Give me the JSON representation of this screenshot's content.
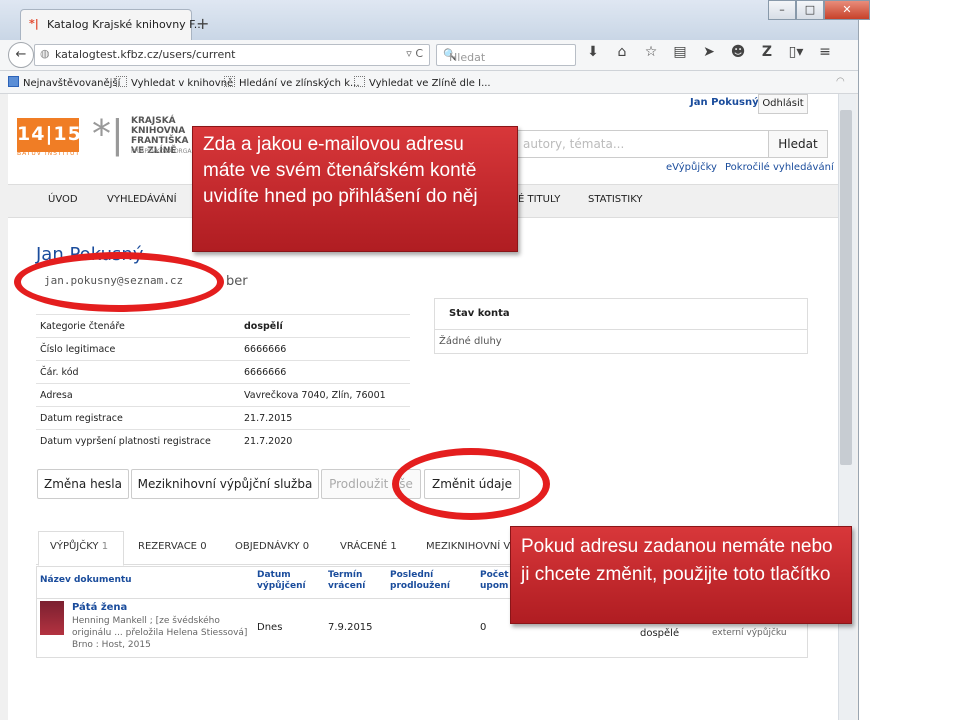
{
  "browser": {
    "tab_title": "Katalog Krajské knihovny F...",
    "tab_favicon": "*|",
    "url": "katalogtest.kfbz.cz/users/current",
    "search_placeholder": "Hledat",
    "bookmarks": [
      "Nejnavštěvovanější",
      "Vyhledat v knihovně",
      "Hledání ve zlínských k...",
      "Vyhledat ve Zlíně dle I..."
    ],
    "icons": [
      "download-icon",
      "home-icon",
      "star-icon",
      "clipboard-icon",
      "send-icon",
      "smiley-icon",
      "z-icon",
      "page-icon",
      "menu-icon"
    ]
  },
  "header": {
    "user_name": "Jan Pokusný",
    "logout": "Odhlásit",
    "logo_number": "14|15",
    "logo_sub": "BAŤŮV INSTITUT",
    "library_name": "KRAJSKÁ KNIHOVNA FRANTIŠKA BA... VE ZLÍNĚ",
    "library_sub": "PŘÍSPĚVKOVÁ ORGANIZ...",
    "search_placeholder": "autory, témata...",
    "search_button": "Hledat",
    "link_evypujcky": "eVýpůjčky",
    "link_advanced": "Pokročilé vyhledávání"
  },
  "menu": [
    "ÚVOD",
    "VYHLEDÁVÁNÍ",
    "É TITULY",
    "STATISTIKY"
  ],
  "profile": {
    "name": "Jan Pokusný",
    "email": "jan.pokusny@seznam.cz",
    "email_suffix": "ber"
  },
  "info_rows": [
    {
      "label": "Kategorie čtenáře",
      "value": "dospělí"
    },
    {
      "label": "Číslo legitimace",
      "value": "6666666"
    },
    {
      "label": "Čár. kód",
      "value": "6666666"
    },
    {
      "label": "Adresa",
      "value": "Vavrečkova 7040, Zlín, 76001"
    },
    {
      "label": "Datum registrace",
      "value": "21.7.2015"
    },
    {
      "label": "Datum vypršení platnosti registrace",
      "value": "21.7.2020"
    }
  ],
  "account": {
    "title": "Stav konta",
    "value": "Žádné dluhy"
  },
  "buttons": {
    "change_password": "Změna hesla",
    "ill": "Meziknihovní výpůjční služba",
    "extend": "Prodloužit vše",
    "change_data": "Změnit údaje"
  },
  "tabs": [
    {
      "label": "VÝPŮJČKY",
      "count": "1"
    },
    {
      "label": "REZERVACE",
      "count": "0"
    },
    {
      "label": "OBJEDNÁVKY",
      "count": "0"
    },
    {
      "label": "VRÁCENÉ",
      "count": "1"
    },
    {
      "label": "MEZIKNIHOVNÍ V",
      "count": ""
    }
  ],
  "loans_table": {
    "headers": [
      "Název dokumentu",
      "Datum výpůjčení",
      "Termín vrácení",
      "Poslední prodloužení",
      "Počet upom"
    ],
    "row": {
      "title": "Pátá žena",
      "author": "Henning Mankell ; [ze švédského originálu ... přeložila Helena Stiessová] Brno : Host, 2015",
      "loan_date": "Dnes",
      "return_date": "7.9.2015",
      "extended": "",
      "reminders": "0",
      "category": "dospělé",
      "note": "externí výpůjčku"
    }
  },
  "annotations": {
    "top": "Zda a jakou e-mailovou adresu máte ve svém čtenářském kontě uvidíte hned po přihlášení do něj",
    "bottom": "Pokud adresu zadanou nemáte nebo ji chcete změnit, použijte toto tlačítko",
    "color": "#c4282c"
  }
}
